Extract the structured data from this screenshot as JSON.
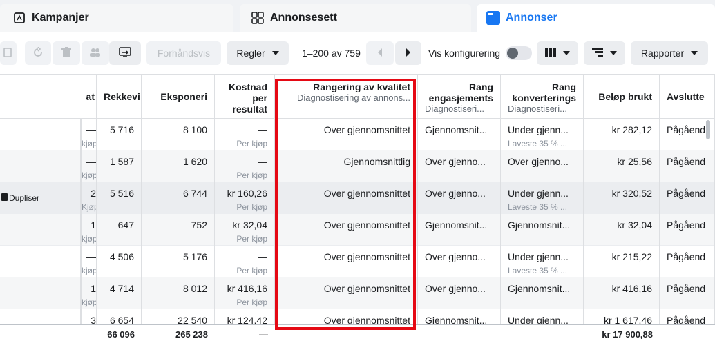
{
  "tabs": [
    {
      "label": "Kampanjer",
      "icon": "flag-icon"
    },
    {
      "label": "Annonsesett",
      "icon": "grid-icon"
    },
    {
      "label": "Annonser",
      "icon": "ad-icon",
      "active": true
    }
  ],
  "toolbar": {
    "preview_label": "Forhåndsvis",
    "rules_label": "Regler",
    "pagination": "1–200 av 759",
    "config_label": "Vis konfigurering",
    "reports_label": "Rapporter"
  },
  "columns": {
    "c0": {
      "label": ""
    },
    "c1": {
      "label": "at"
    },
    "c2": {
      "label": "Rekkevi"
    },
    "c3": {
      "label": "Eksponeri"
    },
    "c4": {
      "label_lines": [
        "Kostnad",
        "per",
        "resultat"
      ]
    },
    "c5": {
      "label": "Rangering av kvalitet",
      "sub": "Diagnostisering av annons..."
    },
    "c6": {
      "label_lines": [
        "Rang",
        "engasjements"
      ],
      "sub": "Diagnostiseri..."
    },
    "c7": {
      "label_lines": [
        "Rang",
        "konverterings"
      ],
      "sub": "Diagnostiseri..."
    },
    "c8": {
      "label": "Beløp brukt"
    },
    "c9": {
      "label": "Avslutte"
    }
  },
  "row_action": {
    "duplicate_label": "Dupliser"
  },
  "rows": [
    {
      "c1": "—",
      "c1s": "kjøp",
      "reach": "5 716",
      "impr": "8 100",
      "cost": "—",
      "cost_s": "Per kjøp",
      "quality": "Over gjennomsnittet",
      "engage": "Gjennomsnit...",
      "engage_s": "",
      "conv": "Under gjenn...",
      "conv_s": "Laveste 35 % ...",
      "spent": "kr 282,12",
      "end": "Pågåend"
    },
    {
      "c1": "—",
      "c1s": "kjøp",
      "reach": "1 587",
      "impr": "1 620",
      "cost": "—",
      "cost_s": "Per kjøp",
      "quality": "Gjennomsnittlig",
      "engage": "Over gjenno...",
      "engage_s": "",
      "conv": "Over gjenno...",
      "conv_s": "",
      "spent": "kr 25,56",
      "end": "Pågåend"
    },
    {
      "c1": "2",
      "c1s": "Kjøp",
      "reach": "5 516",
      "impr": "6 744",
      "cost": "kr 160,26",
      "cost_s": "Per kjøp",
      "quality": "Over gjennomsnittet",
      "engage": "Over gjenno...",
      "engage_s": "",
      "conv": "Under gjenn...",
      "conv_s": "Laveste 35 % ...",
      "spent": "kr 320,52",
      "end": "Pågåend"
    },
    {
      "c1": "1",
      "c1s": "kjøp",
      "reach": "647",
      "impr": "752",
      "cost": "kr 32,04",
      "cost_s": "Per kjøp",
      "quality": "Over gjennomsnittet",
      "engage": "Gjennomsnit...",
      "engage_s": "",
      "conv": "Gjennomsnit...",
      "conv_s": "",
      "spent": "kr 32,04",
      "end": "Pågåend"
    },
    {
      "c1": "—",
      "c1s": "kjøp",
      "reach": "4 506",
      "impr": "5 176",
      "cost": "—",
      "cost_s": "Per kjøp",
      "quality": "Over gjennomsnittet",
      "engage": "Over gjenno...",
      "engage_s": "",
      "conv": "Under gjenn...",
      "conv_s": "Laveste 35 % ...",
      "spent": "kr 215,22",
      "end": "Pågåend"
    },
    {
      "c1": "1",
      "c1s": "kjøp",
      "reach": "4 714",
      "impr": "8 012",
      "cost": "kr 416,16",
      "cost_s": "Per kjøp",
      "quality": "Over gjennomsnittet",
      "engage": "Over gjenno...",
      "engage_s": "",
      "conv": "Gjennomsnit...",
      "conv_s": "",
      "spent": "kr 416,16",
      "end": "Pågåend"
    },
    {
      "c1": "3",
      "c1s": "",
      "reach": "6 654",
      "impr": "22 540",
      "cost": "kr 124,42",
      "cost_s": "",
      "quality": "Over gjennomsnittet",
      "engage": "Gjennomsnit...",
      "engage_s": "",
      "conv": "Under gjenn...",
      "conv_s": "",
      "spent": "kr 1 617,46",
      "end": "Pågåend"
    }
  ],
  "totals": {
    "reach": "66 096",
    "impr": "265 238",
    "cost": "—",
    "spent": "kr 17 900,88"
  },
  "colors": {
    "accent": "#1877f2",
    "highlight": "#e50914"
  }
}
